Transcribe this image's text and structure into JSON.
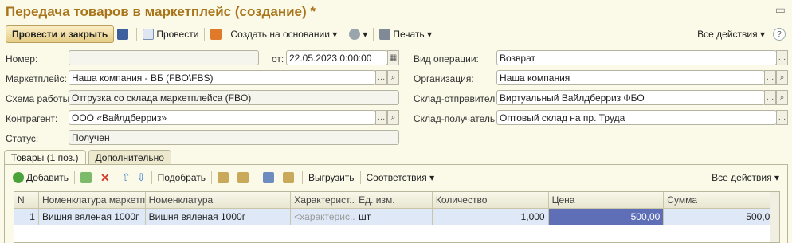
{
  "window": {
    "title": "Передача товаров в маркетплейс (создание) *"
  },
  "toolbar": {
    "post_close": "Провести и закрыть",
    "post": "Провести",
    "create_based": "Создать на основании",
    "print": "Печать",
    "all_actions": "Все действия",
    "help": "?"
  },
  "form": {
    "number_label": "Номер:",
    "number_value": "",
    "date_label": "от:",
    "date_value": "22.05.2023  0:00:00",
    "marketplace_label": "Маркетплейс:",
    "marketplace_value": "Наша компания - ВБ (FBO\\FBS)",
    "scheme_label": "Схема работы:",
    "scheme_value": "Отгрузка со склада маркетплейса (FBO)",
    "counterparty_label": "Контрагент:",
    "counterparty_value": "ООО «Вайлдберриз»",
    "status_label": "Статус:",
    "status_value": "Получен",
    "operation_label": "Вид операции:",
    "operation_value": "Возврат",
    "org_label": "Организация:",
    "org_value": "Наша компания",
    "sender_label": "Склад-отправитель:",
    "sender_value": "Виртуальный Вайлдберриз ФБО",
    "receiver_label": "Склад-получатель:",
    "receiver_value": "Оптовый склад на пр. Труда"
  },
  "tabs": [
    {
      "label": "Товары (1 поз.)"
    },
    {
      "label": "Дополнительно"
    }
  ],
  "goods_toolbar": {
    "add": "Добавить",
    "select": "Подобрать",
    "export": "Выгрузить",
    "match": "Соответствия",
    "all_actions": "Все действия"
  },
  "table": {
    "headers": [
      "N",
      "Номенклатура маркетп...",
      "Номенклатура",
      "Характерист...",
      "Ед. изм.",
      "Количество",
      "Цена",
      "Сумма"
    ],
    "rows": [
      {
        "n": "1",
        "mp_item": "Вишня вяленая 1000г",
        "item": "Вишня вяленая 1000г",
        "char": "<характерис...",
        "unit": "шт",
        "qty": "1,000",
        "price": "500,00",
        "sum": "500,00"
      }
    ]
  },
  "colors": {
    "title": "#a8741a",
    "selected_cell": "#5e6fb8",
    "row_bg": "#dfe8f6"
  }
}
